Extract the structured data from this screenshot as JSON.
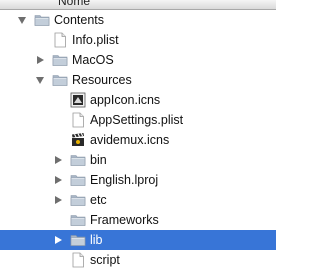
{
  "header": {
    "column_label": "Nome"
  },
  "tree": [
    {
      "label": "Contents",
      "kind": "folder",
      "expander": "down",
      "indent": 0
    },
    {
      "label": "Info.plist",
      "kind": "doc",
      "expander": "none",
      "indent": 1
    },
    {
      "label": "MacOS",
      "kind": "folder",
      "expander": "right",
      "indent": 1
    },
    {
      "label": "Resources",
      "kind": "folder",
      "expander": "down",
      "indent": 1
    },
    {
      "label": "appIcon.icns",
      "kind": "icns",
      "expander": "none",
      "indent": 2
    },
    {
      "label": "AppSettings.plist",
      "kind": "doc",
      "expander": "none",
      "indent": 2
    },
    {
      "label": "avidemux.icns",
      "kind": "clapper",
      "expander": "none",
      "indent": 2
    },
    {
      "label": "bin",
      "kind": "folder",
      "expander": "right",
      "indent": 2
    },
    {
      "label": "English.lproj",
      "kind": "folder",
      "expander": "right",
      "indent": 2
    },
    {
      "label": "etc",
      "kind": "folder",
      "expander": "right",
      "indent": 2
    },
    {
      "label": "Frameworks",
      "kind": "folder",
      "expander": "none",
      "indent": 2
    },
    {
      "label": "lib",
      "kind": "folder",
      "expander": "right",
      "indent": 2,
      "selected": true
    },
    {
      "label": "script",
      "kind": "doc",
      "expander": "none",
      "indent": 2
    }
  ]
}
